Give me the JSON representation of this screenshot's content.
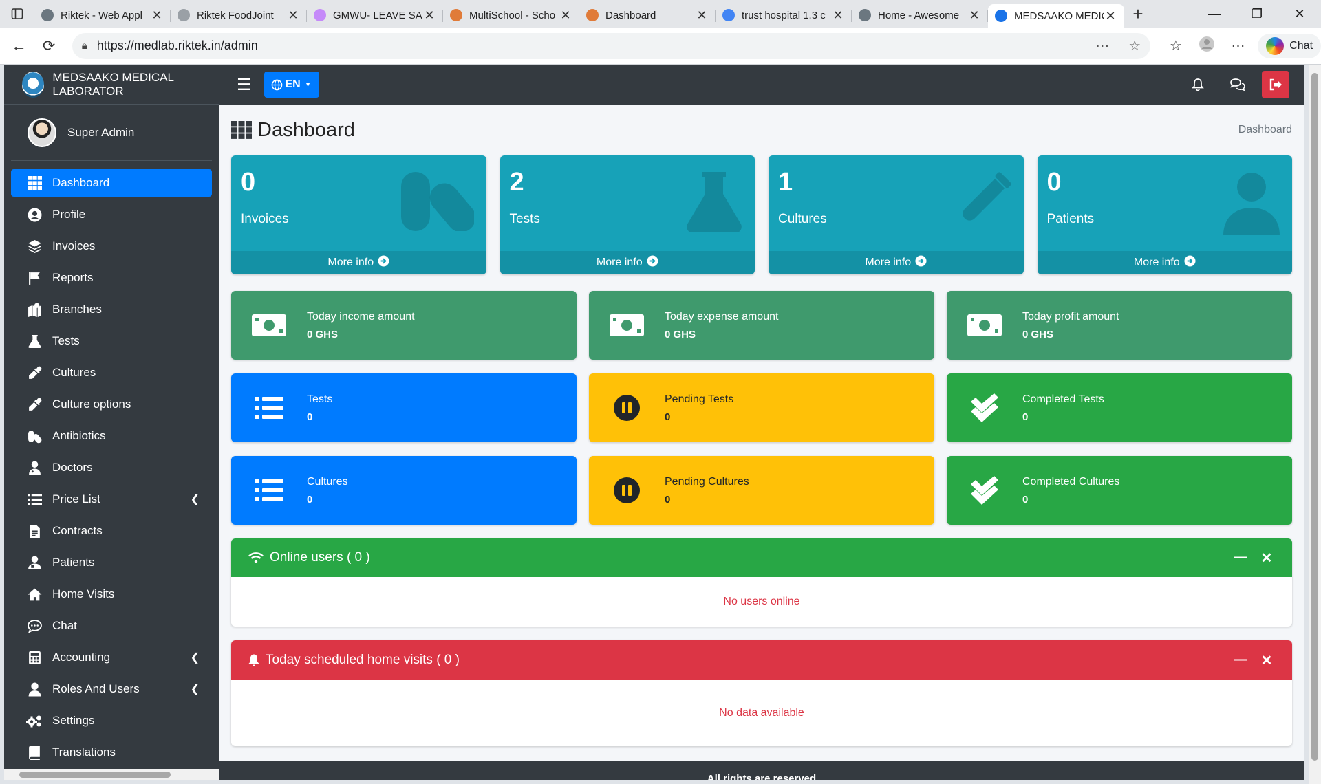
{
  "browser": {
    "tabs": [
      {
        "title": "Riktek - Web Appl",
        "active": false
      },
      {
        "title": "Riktek FoodJoint",
        "active": false
      },
      {
        "title": "GMWU- LEAVE SA",
        "active": false
      },
      {
        "title": "MultiSchool - Scho",
        "active": false
      },
      {
        "title": "Dashboard",
        "active": false
      },
      {
        "title": "trust hospital 1.3 c",
        "active": false
      },
      {
        "title": "Home - Awesome",
        "active": false
      },
      {
        "title": "MEDSAAKO MEDIC",
        "active": true
      }
    ],
    "url": "https://medlab.riktek.in/admin",
    "chat_label": "Chat"
  },
  "sidebar": {
    "brand": "MEDSAAKO MEDICAL LABORATOR",
    "user": "Super Admin",
    "items": [
      {
        "label": "Dashboard",
        "icon": "grid-icon",
        "active": true,
        "arrow": false
      },
      {
        "label": "Profile",
        "icon": "user-circle-icon",
        "active": false,
        "arrow": false
      },
      {
        "label": "Invoices",
        "icon": "layers-icon",
        "active": false,
        "arrow": false
      },
      {
        "label": "Reports",
        "icon": "flag-icon",
        "active": false,
        "arrow": false
      },
      {
        "label": "Branches",
        "icon": "map-icon",
        "active": false,
        "arrow": false
      },
      {
        "label": "Tests",
        "icon": "flask-icon",
        "active": false,
        "arrow": false
      },
      {
        "label": "Cultures",
        "icon": "eyedropper-icon",
        "active": false,
        "arrow": false
      },
      {
        "label": "Culture options",
        "icon": "eyedropper-icon",
        "active": false,
        "arrow": false
      },
      {
        "label": "Antibiotics",
        "icon": "pills-icon",
        "active": false,
        "arrow": false
      },
      {
        "label": "Doctors",
        "icon": "doctor-icon",
        "active": false,
        "arrow": false
      },
      {
        "label": "Price List",
        "icon": "list-icon",
        "active": false,
        "arrow": true
      },
      {
        "label": "Contracts",
        "icon": "file-icon",
        "active": false,
        "arrow": false
      },
      {
        "label": "Patients",
        "icon": "patient-icon",
        "active": false,
        "arrow": false
      },
      {
        "label": "Home Visits",
        "icon": "home-icon",
        "active": false,
        "arrow": false
      },
      {
        "label": "Chat",
        "icon": "comment-icon",
        "active": false,
        "arrow": false
      },
      {
        "label": "Accounting",
        "icon": "calculator-icon",
        "active": false,
        "arrow": true
      },
      {
        "label": "Roles And Users",
        "icon": "user-icon",
        "active": false,
        "arrow": true
      },
      {
        "label": "Settings",
        "icon": "cogs-icon",
        "active": false,
        "arrow": false
      },
      {
        "label": "Translations",
        "icon": "book-icon",
        "active": false,
        "arrow": false
      }
    ]
  },
  "topnav": {
    "lang": "EN"
  },
  "header": {
    "title": "Dashboard",
    "breadcrumb": "Dashboard"
  },
  "small_boxes": [
    {
      "value": "0",
      "label": "Invoices",
      "more": "More info",
      "icon": "pills-icon"
    },
    {
      "value": "2",
      "label": "Tests",
      "more": "More info",
      "icon": "flask-icon"
    },
    {
      "value": "1",
      "label": "Cultures",
      "more": "More info",
      "icon": "test-tube-icon"
    },
    {
      "value": "0",
      "label": "Patients",
      "more": "More info",
      "icon": "patient-icon"
    }
  ],
  "info_boxes": [
    {
      "label": "Today income amount",
      "value": "0 GHS",
      "color": "#3f9a6d",
      "icon": "money-icon"
    },
    {
      "label": "Today expense amount",
      "value": "0 GHS",
      "color": "#3f9a6d",
      "icon": "money-icon"
    },
    {
      "label": "Today profit amount",
      "value": "0 GHS",
      "color": "#3f9a6d",
      "icon": "money-icon"
    },
    {
      "label": "Tests",
      "value": "0",
      "color": "#007bff",
      "icon": "list-icon"
    },
    {
      "label": "Pending Tests",
      "value": "0",
      "color": "#ffc107",
      "icon": "pause-icon"
    },
    {
      "label": "Completed Tests",
      "value": "0",
      "color": "#28a745",
      "icon": "check-double-icon"
    },
    {
      "label": "Cultures",
      "value": "0",
      "color": "#007bff",
      "icon": "list-icon"
    },
    {
      "label": "Pending Cultures",
      "value": "0",
      "color": "#ffc107",
      "icon": "pause-icon"
    },
    {
      "label": "Completed Cultures",
      "value": "0",
      "color": "#28a745",
      "icon": "check-double-icon"
    }
  ],
  "online_users": {
    "title": "Online users ( 0 )",
    "empty": "No users online",
    "color": "#28a745"
  },
  "home_visits": {
    "title": "Today scheduled home visits ( 0 )",
    "empty": "No data available",
    "color": "#dc3545"
  },
  "footer": {
    "text": "All rights are reserved"
  },
  "colors": {
    "sidebar": "#343a40",
    "primary": "#007bff",
    "info": "#17a2b8",
    "success": "#28a745",
    "warning": "#ffc107",
    "danger": "#dc3545"
  }
}
